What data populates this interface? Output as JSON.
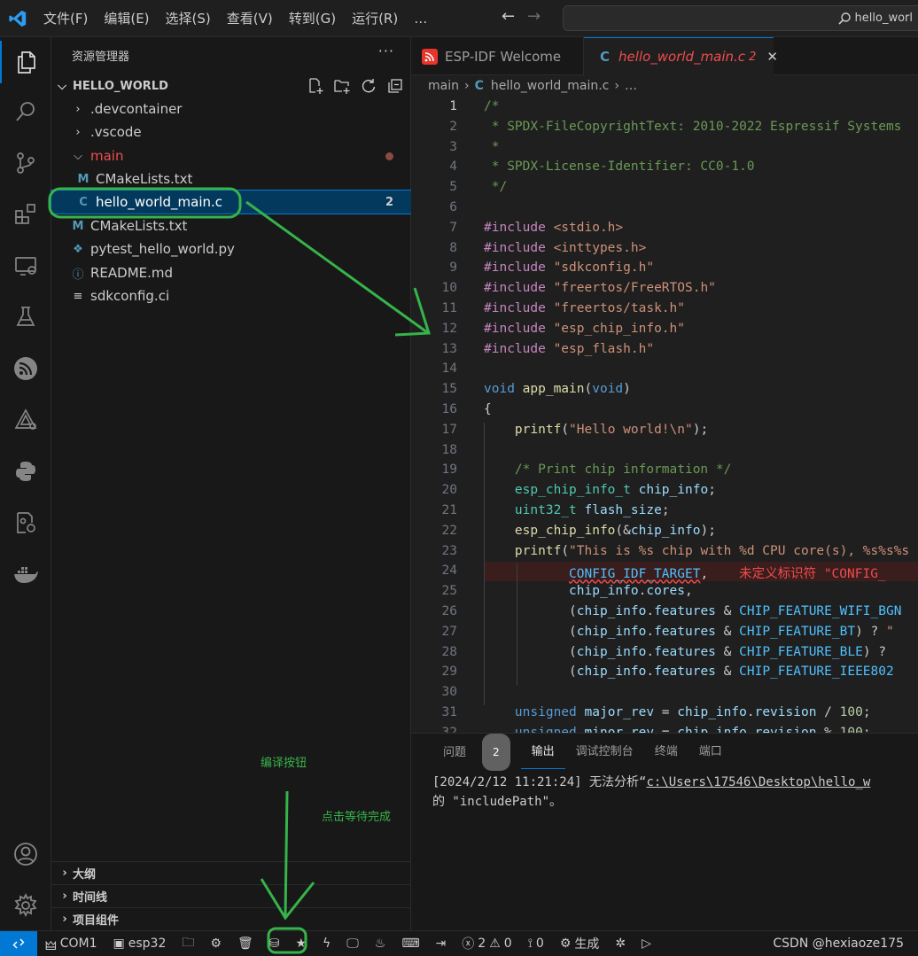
{
  "menubar": {
    "items": [
      "文件(F)",
      "编辑(E)",
      "选择(S)",
      "查看(V)",
      "转到(G)",
      "运行(R)",
      "…"
    ],
    "search_text": "hello_worl"
  },
  "sidebar": {
    "title": "资源管理器",
    "more": "···",
    "root_folder": "HELLO_WORLD",
    "items": [
      {
        "label": ".devcontainer",
        "icon": "chevron-right"
      },
      {
        "label": ".vscode",
        "icon": "chevron-right"
      },
      {
        "label": "main",
        "icon": "chevron-down"
      },
      {
        "label": "CMakeLists.txt",
        "icon": "M"
      },
      {
        "label": "hello_world_main.c",
        "icon": "C",
        "badge": "2"
      },
      {
        "label": "CMakeLists.txt",
        "icon": "M"
      },
      {
        "label": "pytest_hello_world.py",
        "icon": "python"
      },
      {
        "label": "README.md",
        "icon": "info"
      },
      {
        "label": "sdkconfig.ci",
        "icon": "lines"
      }
    ],
    "bottom_sections": [
      "大纲",
      "时间线",
      "项目组件"
    ]
  },
  "editor": {
    "tabs": [
      {
        "label": "ESP-IDF Welcome"
      },
      {
        "label": "hello_world_main.c",
        "badge": "2",
        "close": "✕"
      }
    ],
    "breadcrumb": [
      "main",
      "hello_world_main.c",
      "…"
    ],
    "lines": [
      "/*",
      " * SPDX-FileCopyrightText: 2010-2022 Espressif Systems",
      " *",
      " * SPDX-License-Identifier: CC0-1.0",
      " */",
      "",
      "#include <stdio.h>",
      "#include <inttypes.h>",
      "#include \"sdkconfig.h\"",
      "#include \"freertos/FreeRTOS.h\"",
      "#include \"freertos/task.h\"",
      "#include \"esp_chip_info.h\"",
      "#include \"esp_flash.h\"",
      "",
      "void app_main(void)",
      "{",
      "    printf(\"Hello world!\\n\");",
      "",
      "    /* Print chip information */",
      "    esp_chip_info_t chip_info;",
      "    uint32_t flash_size;",
      "    esp_chip_info(&chip_info);",
      "    printf(\"This is %s chip with %d CPU core(s), %s%s%s",
      "           CONFIG_IDF_TARGET,",
      "           chip_info.cores,",
      "           (chip_info.features & CHIP_FEATURE_WIFI_BGN",
      "           (chip_info.features & CHIP_FEATURE_BT) ? \"",
      "           (chip_info.features & CHIP_FEATURE_BLE) ?",
      "           (chip_info.features & CHIP_FEATURE_IEEE802",
      "",
      "    unsigned major_rev = chip_info.revision / 100;",
      "    unsigned minor_rev = chip_info.revision % 100;"
    ],
    "error_hint": "未定义标识符 \"CONFIG_"
  },
  "panel": {
    "tabs": [
      "问题",
      "输出",
      "调试控制台",
      "终端",
      "端口"
    ],
    "problem_count": "2",
    "output_line1_a": "[2024/2/12 11:21:24] 无法分析“",
    "output_line1_b": "c:\\Users\\17546\\Desktop\\hello_w",
    "output_line2": "的 \"includePath\"。"
  },
  "statusbar": {
    "port": "COM1",
    "target": "esp32",
    "errors": "2",
    "warnings": "0",
    "radio": "0",
    "build": "生成",
    "credit": "CSDN @hexiaoze175"
  },
  "annotations": {
    "build_button_label": "编译按钮",
    "wait_label": "点击等待完成"
  },
  "colors": {
    "accent": "#0078d4",
    "annotation_green": "#36b34a",
    "error_red": "#f14c4c"
  }
}
